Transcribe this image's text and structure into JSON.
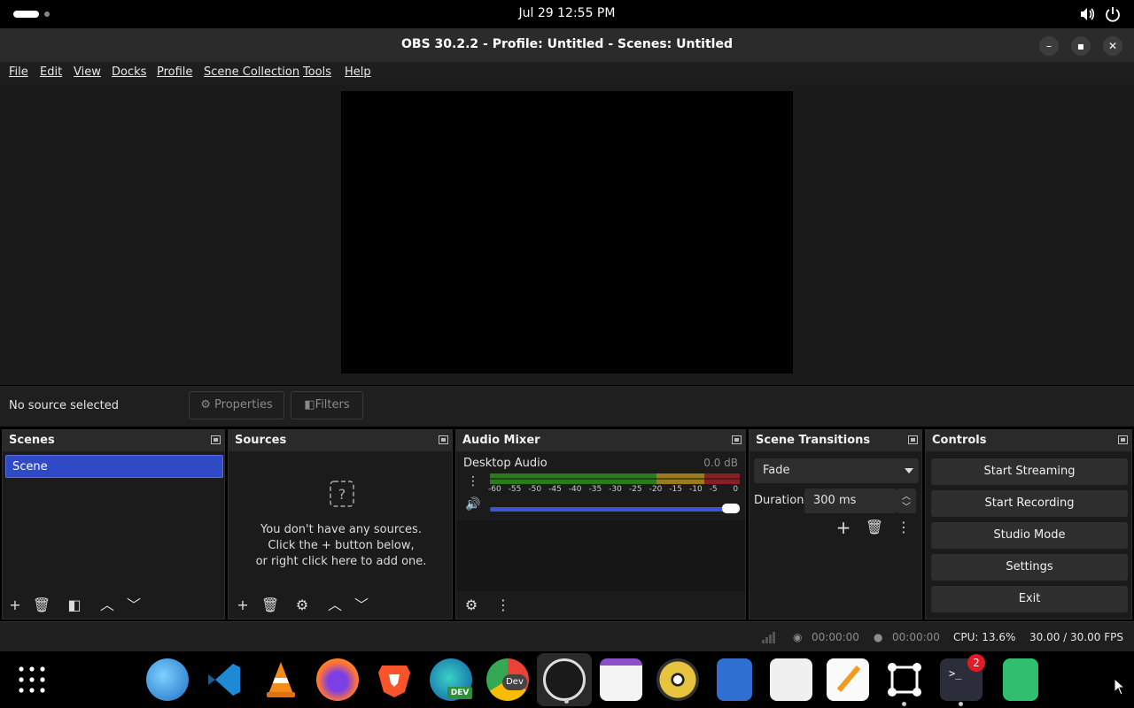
{
  "topbar": {
    "clock": "Jul 29  12:55 PM"
  },
  "window": {
    "title": "OBS 30.2.2 - Profile: Untitled - Scenes: Untitled"
  },
  "menu": [
    "File",
    "Edit",
    "View",
    "Docks",
    "Profile",
    "Scene Collection",
    "Tools",
    "Help"
  ],
  "sourcebar": {
    "status": "No source selected",
    "properties_label": "Properties",
    "filters_label": "Filters"
  },
  "scenes": {
    "title": "Scenes",
    "items": [
      "Scene"
    ]
  },
  "sources": {
    "title": "Sources",
    "empty_line1": "You don't have any sources.",
    "empty_line2": "Click the + button below,",
    "empty_line3": "or right click here to add one."
  },
  "mixer": {
    "title": "Audio Mixer",
    "channel": "Desktop Audio",
    "level": "0.0 dB",
    "scale": [
      "-60",
      "-55",
      "-50",
      "-45",
      "-40",
      "-35",
      "-30",
      "-25",
      "-20",
      "-15",
      "-10",
      "-5",
      "0"
    ],
    "volume_fraction": 1.0
  },
  "transitions": {
    "title": "Scene Transitions",
    "selected": "Fade",
    "duration_label": "Duration",
    "duration_value": "300 ms"
  },
  "controls": {
    "title": "Controls",
    "buttons": [
      "Start Streaming",
      "Start Recording",
      "Studio Mode",
      "Settings",
      "Exit"
    ]
  },
  "status": {
    "stream_time": "00:00:00",
    "record_time": "00:00:00",
    "cpu": "CPU: 13.6%",
    "fps": "30.00 / 30.00 FPS"
  },
  "taskbar": {
    "apps": [
      "app-grid",
      "web-browser",
      "vscode",
      "vlc",
      "firefox",
      "brave",
      "edge-dev",
      "chrome-dev",
      "obs",
      "calendar",
      "rhythmbox",
      "files",
      "software-store",
      "text-editor",
      "screenshot",
      "terminal",
      "trash"
    ],
    "terminal_badge": "2",
    "edge_label": "DEV",
    "chrome_label": "Dev"
  },
  "colors": {
    "accent": "#2f4ac4",
    "background": "#1b1b1b",
    "meter_green": "#2b7a1b",
    "meter_yellow": "#9a7d1a",
    "meter_red": "#8a1e26"
  }
}
